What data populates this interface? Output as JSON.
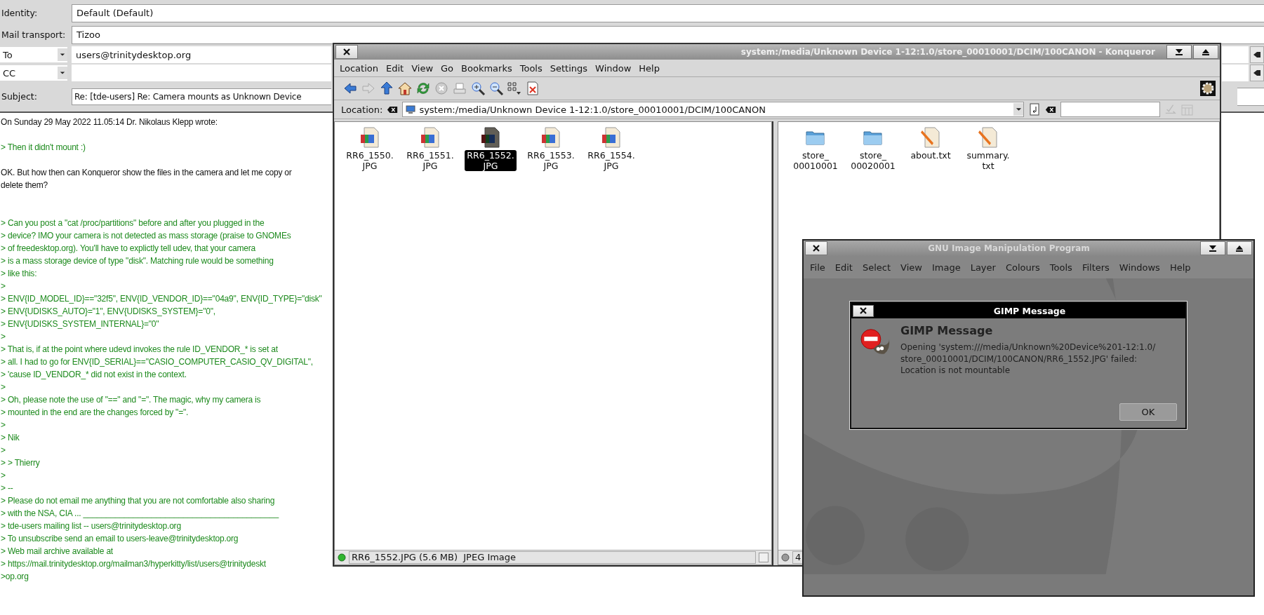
{
  "composer": {
    "identity": {
      "label": "Identity:",
      "value": "Default (Default)"
    },
    "transport": {
      "label": "Mail transport:",
      "value": "Tizoo"
    },
    "recipients": [
      {
        "type": "To",
        "address": "users@trinitydesktop.org"
      },
      {
        "type": "CC"
      }
    ],
    "subject": {
      "label": "Subject:",
      "value": "Re: [tde-users] Re: Camera mounts as Unknown Device"
    },
    "body": [
      {
        "kind": "text",
        "text": "On Sunday 29 May 2022 11.05:14 Dr. Nikolaus Klepp wrote:"
      },
      {
        "kind": "blank"
      },
      {
        "kind": "quote",
        "text": "> Then it didn't mount :)"
      },
      {
        "kind": "blank"
      },
      {
        "kind": "text",
        "text": "OK. But how then can Konqueror show the files in the camera and let me copy or"
      },
      {
        "kind": "text",
        "text": "delete them?"
      },
      {
        "kind": "blank"
      },
      {
        "kind": "blank"
      },
      {
        "kind": "quote",
        "text": "> Can you post a \"cat /proc/partitions\" before and after you plugged in the"
      },
      {
        "kind": "quote",
        "text": "> device? IMO your camera is not detected as mass storage (praise to GNOMEs"
      },
      {
        "kind": "quote",
        "text": "> of freedesktop.org). You'll have to explictly tell udev, that your camera"
      },
      {
        "kind": "quote",
        "text": "> is a mass storage device of type \"disk\". Matching rule would be something"
      },
      {
        "kind": "quote",
        "text": "> like this:"
      },
      {
        "kind": "quote",
        "text": ">"
      },
      {
        "kind": "quote",
        "text": "> ENV{ID_MODEL_ID}==\"32f5\", ENV{ID_VENDOR_ID}==\"04a9\", ENV{ID_TYPE}=\"disk\""
      },
      {
        "kind": "quote",
        "text": "> ENV{UDISKS_AUTO}=\"1\", ENV{UDISKS_SYSTEM}=\"0\","
      },
      {
        "kind": "quote",
        "text": "> ENV{UDISKS_SYSTEM_INTERNAL}=\"0\""
      },
      {
        "kind": "quote",
        "text": ">"
      },
      {
        "kind": "quote",
        "text": "> That is, if at the point where udevd invokes the rule ID_VENDOR_* is set at"
      },
      {
        "kind": "quote",
        "text": "> all. I had to go for ENV{ID_SERIAL}==\"CASIO_COMPUTER_CASIO_QV_DIGITAL\","
      },
      {
        "kind": "quote",
        "text": "> 'cause ID_VENDOR_* did not exist in the context."
      },
      {
        "kind": "quote",
        "text": ">"
      },
      {
        "kind": "quote",
        "text": "> Oh, please note the use of \"==\" and \"=\". The magic, why my camera is"
      },
      {
        "kind": "quote",
        "text": "> mounted in the end are the changes forced by \"=\"."
      },
      {
        "kind": "quote",
        "text": ">"
      },
      {
        "kind": "quote",
        "text": "> Nik"
      },
      {
        "kind": "quote",
        "text": ">"
      },
      {
        "kind": "quote",
        "text": "> > Thierry"
      },
      {
        "kind": "quote",
        "text": ">"
      },
      {
        "kind": "quote",
        "text": "> --"
      },
      {
        "kind": "quote",
        "text": "> Please do not email me anything that you are not comfortable also sharing"
      },
      {
        "kind": "quote",
        "text": "> with the NSA, CIA ... ___________________________________________"
      },
      {
        "kind": "quote",
        "text": "> tde-users mailing list -- users@trinitydesktop.org"
      },
      {
        "kind": "quote",
        "text": "> To unsubscribe send an email to users-leave@trinitydesktop.org"
      },
      {
        "kind": "quote",
        "text": "> Web mail archive available at"
      },
      {
        "kind": "quote",
        "text": "> https://mail.trinitydesktop.org/mailman3/hyperkitty/list/users@trinitydeskt"
      },
      {
        "kind": "quote",
        "text": ">op.org"
      }
    ]
  },
  "konqueror": {
    "title": "system:/media/Unknown Device 1-12:1.0/store_00010001/DCIM/100CANON - Konqueror",
    "menus": [
      "Location",
      "Edit",
      "View",
      "Go",
      "Bookmarks",
      "Tools",
      "Settings",
      "Window",
      "Help"
    ],
    "location_label": "Location:",
    "url": "system:/media/Unknown Device 1-12:1.0/store_00010001/DCIM/100CANON",
    "left_files": [
      {
        "kind": "image",
        "lines": [
          "RR6_1550.",
          "JPG"
        ],
        "selected": false
      },
      {
        "kind": "image",
        "lines": [
          "RR6_1551.",
          "JPG"
        ],
        "selected": false
      },
      {
        "kind": "image",
        "lines": [
          "RR6_1552.",
          "JPG"
        ],
        "selected": true
      },
      {
        "kind": "image",
        "lines": [
          "RR6_1553.",
          "JPG"
        ],
        "selected": false
      },
      {
        "kind": "image",
        "lines": [
          "RR6_1554.",
          "JPG"
        ],
        "selected": false
      }
    ],
    "right_files": [
      {
        "kind": "folder",
        "lines": [
          "store_",
          "00010001"
        ],
        "selected": false
      },
      {
        "kind": "folder",
        "lines": [
          "store_",
          "00020001"
        ],
        "selected": false
      },
      {
        "kind": "text",
        "lines": [
          "about.txt"
        ],
        "selected": false
      },
      {
        "kind": "text",
        "lines": [
          "summary.",
          "txt"
        ],
        "selected": false
      }
    ],
    "status": "RR6_1552.JPG (5.6 MB)  JPEG Image",
    "link_checked": false,
    "right_status": "4"
  },
  "gimp": {
    "title": "GNU Image Manipulation Program",
    "menus": [
      "File",
      "Edit",
      "Select",
      "View",
      "Image",
      "Layer",
      "Colours",
      "Tools",
      "Filters",
      "Windows",
      "Help"
    ],
    "dialog": {
      "title": "GIMP Message",
      "heading": "GIMP Message",
      "message": "Opening 'system:///media/Unknown%20Device%201-12:1.0/\nstore_00010001/DCIM/100CANON/RR6_1552.JPG' failed:\nLocation is not mountable",
      "button": "OK"
    }
  }
}
